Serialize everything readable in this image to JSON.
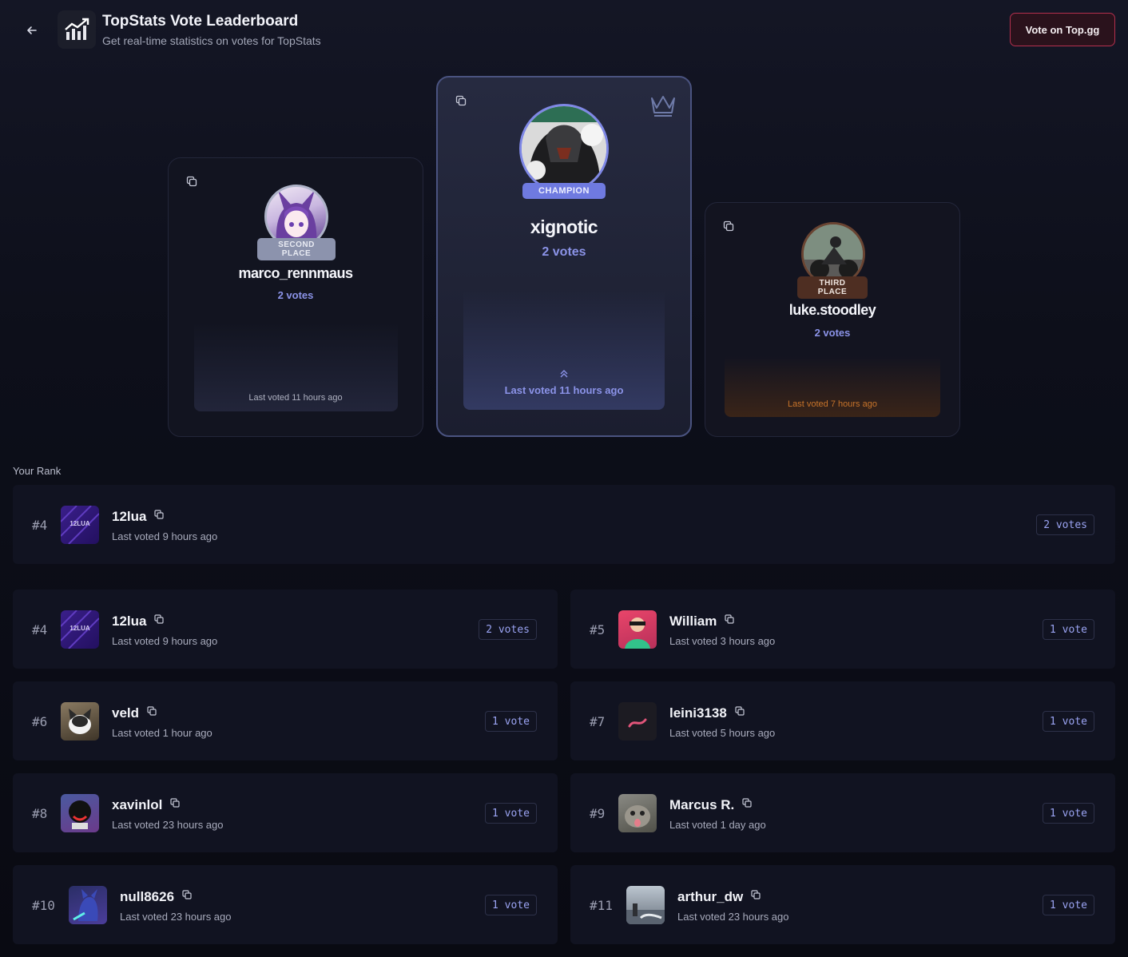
{
  "header": {
    "title": "TopStats Vote Leaderboard",
    "subtitle": "Get real-time statistics on votes for TopStats",
    "vote_button": "Vote on Top.gg"
  },
  "podium": {
    "first": {
      "badge": "CHAMPION",
      "name": "xignotic",
      "votes": "2 votes",
      "last_voted": "Last voted 11 hours ago"
    },
    "second": {
      "badge": "SECOND PLACE",
      "name": "marco_rennmaus",
      "votes": "2 votes",
      "last_voted": "Last voted 11 hours ago"
    },
    "third": {
      "badge": "THIRD PLACE",
      "name": "luke.stoodley",
      "votes": "2 votes",
      "last_voted": "Last voted 7 hours ago"
    }
  },
  "your_rank": {
    "label": "Your Rank",
    "rank": "#4",
    "name": "12lua",
    "last_voted": "Last voted 9 hours ago",
    "votes": "2 votes",
    "avatar_text": "12LUA"
  },
  "leaderboard": [
    {
      "rank": "#4",
      "name": "12lua",
      "last_voted": "Last voted 9 hours ago",
      "votes": "2 votes",
      "avatar_text": "12LUA"
    },
    {
      "rank": "#5",
      "name": "William",
      "last_voted": "Last voted 3 hours ago",
      "votes": "1 vote"
    },
    {
      "rank": "#6",
      "name": "veld",
      "last_voted": "Last voted 1 hour ago",
      "votes": "1 vote"
    },
    {
      "rank": "#7",
      "name": "leini3138",
      "last_voted": "Last voted 5 hours ago",
      "votes": "1 vote"
    },
    {
      "rank": "#8",
      "name": "xavinlol",
      "last_voted": "Last voted 23 hours ago",
      "votes": "1 vote"
    },
    {
      "rank": "#9",
      "name": "Marcus R.",
      "last_voted": "Last voted 1 day ago",
      "votes": "1 vote"
    },
    {
      "rank": "#10",
      "name": "null8626",
      "last_voted": "Last voted 23 hours ago",
      "votes": "1 vote"
    },
    {
      "rank": "#11",
      "name": "arthur_dw",
      "last_voted": "Last voted 23 hours ago",
      "votes": "1 vote"
    }
  ],
  "colors": {
    "accent": "#8b93e8",
    "vote_button_border": "#b3304e",
    "third_place": "#c8742a",
    "champion_badge": "#6f7ae0",
    "second_badge": "#8c93ad"
  }
}
